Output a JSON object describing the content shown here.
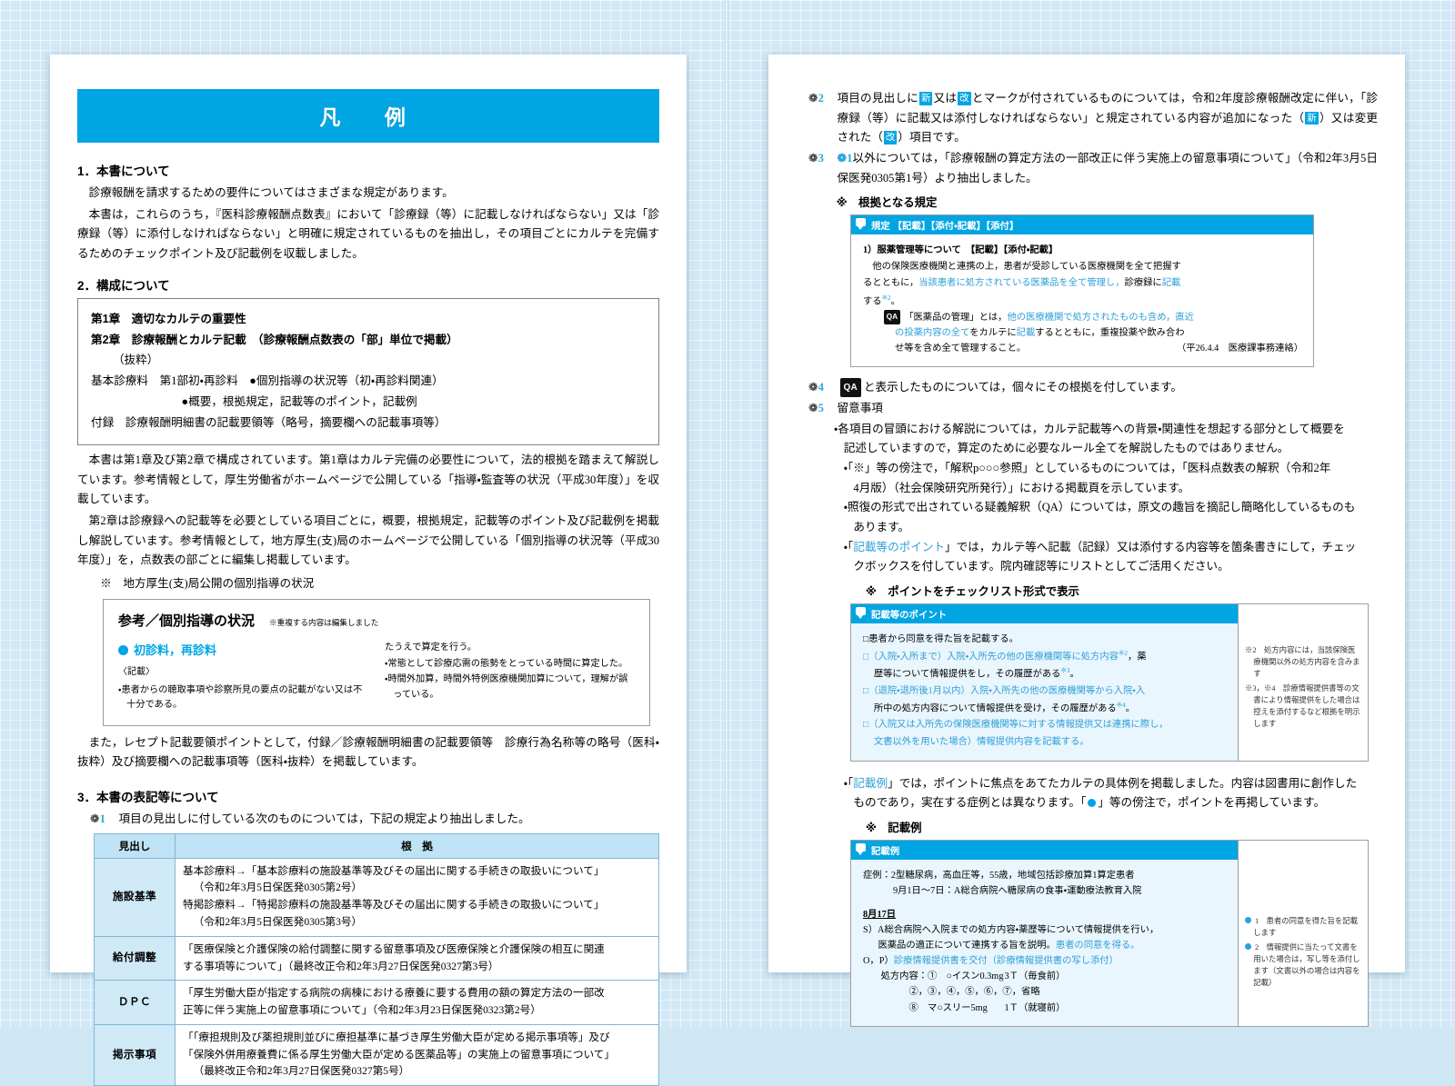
{
  "left_page": {
    "banner_title": "凡　例",
    "section1": {
      "heading": "1．本書について",
      "p1": "診療報酬を請求するための要件についてはさまざまな規定があります。",
      "p2": "本書は，これらのうち，『医科診療報酬点数表』において「診療録（等）に記載しなければならない」又は「診療録（等）に添付しなければならない」と明確に規定されているものを抽出し，その項目ごとにカルテを完備するためのチェックポイント及び記載例を収載しました。"
    },
    "section2": {
      "heading": "2．構成について",
      "outline": {
        "line1": "第1章　適切なカルテの重要性",
        "line2": "第2章　診療報酬とカルテ記載　（診療報酬点数表の「部」単位で掲載）",
        "line3": "（抜粋）",
        "line4": "基本診療料　第1部初・再診料　●個別指導の状況等（初・再診料関連）",
        "line5": "●概要，根拠規定，記載等のポイント，記載例",
        "line6": "付録　診療報酬明細書の記載要領等（略号，摘要欄への記載事項等）"
      },
      "p1": "本書は第1章及び第2章で構成されています。第1章はカルテ完備の必要性について，法的根拠を踏まえて解説しています。参考情報として，厚生労働省がホームページで公開している「指導・監査等の状況（平成30年度）」を収載しています。",
      "p2": "第2章は診療録への記載等を必要としている項目ごとに，概要，根拠規定，記載等のポイント及び記載例を掲載し解説しています。参考情報として，地方厚生(支)局のホームページで公開している「個別指導の状況等（平成30年度）」を，点数表の部ごとに編集し掲載しています。",
      "note": "※　地方厚生(支)局公開の個別指導の状況",
      "ref_box": {
        "title": "参考／個別指導の状況",
        "subtitle": "※重複する内容は編集しました",
        "col1_head": "初診料，再診料",
        "col1_label": "〈記載〉",
        "col1_item1": "・患者からの聴取事項や診察所見の要点の記載がない又は不十分である。",
        "col2_item0": "たうえで算定を行う。",
        "col2_item1": "・常態として診療応需の態勢をとっている時間に算定した。",
        "col2_item2": "・時間外加算，時間外特例医療機関加算について，理解が誤っている。"
      },
      "p3": "また，レセプト記載要領ポイントとして，付録／診療報酬明細書の記載要領等　診療行為名称等の略号（医科・抜粋）及び摘要欄への記載事項等（医科・抜粋）を掲載しています。"
    },
    "section3": {
      "heading": "3．本書の表記等について",
      "note1_num": "1",
      "note1": "項目の見出しに付している次のものについては，下記の規定より抽出しました。",
      "table": {
        "headers": [
          "見出し",
          "根　拠"
        ],
        "rows": [
          {
            "label": "施設基準",
            "lines": [
              "基本診療料→「基本診療料の施設基準等及びその届出に関する手続きの取扱いについて」",
              "（令和2年3月5日保医発0305第2号）",
              "特掲診療料→「特掲診療料の施設基準等及びその届出に関する手続きの取扱いについて」",
              "（令和2年3月5日保医発0305第3号）"
            ]
          },
          {
            "label": "給付調整",
            "lines": [
              "「医療保険と介護保険の給付調整に関する留意事項及び医療保険と介護保険の相互に関連",
              "する事項等について」（最終改正令和2年3月27日保医発0327第3号）"
            ]
          },
          {
            "label": "ＤＰＣ",
            "lines": [
              "「厚生労働大臣が指定する病院の病棟における療養に要する費用の額の算定方法の一部改",
              "正等に伴う実施上の留意事項について」（令和2年3月23日保医発0323第2号）"
            ]
          },
          {
            "label": "掲示事項",
            "lines": [
              "「「療担規則及び薬担規則並びに療担基準に基づき厚生労働大臣が定める掲示事項等」及び",
              "「保険外併用療養費に係る厚生労働大臣が定める医薬品等」の実施上の留意事項について」",
              "（最終改正令和2年3月27日保医発0327第5号）"
            ]
          }
        ]
      }
    }
  },
  "right_page": {
    "note2": {
      "num": "2",
      "tag_new": "新",
      "tag_kai": "改",
      "line1_a": "項目の見出しに",
      "line1_b": "又は",
      "line1_c": "とマークが付されているものについては，令和2年度診療報酬改定に伴い，",
      "line2_a": "「診療録（等）に記載又は添付しなければならない」と規定されている内容が追加になった（",
      "line2_b": "）又は",
      "line3_a": "変更された（",
      "line3_b": "）項目です。"
    },
    "note3": {
      "num": "3",
      "ref_num": "1",
      "text_a": "以外については，「診療報酬の算定方法の一部改正に伴う実施上の留意事項について」（令和2年",
      "text_b": "3月5日保医発0305第1号）より抽出しました。"
    },
    "kitei_label": "※　根拠となる規定",
    "kitei_panel": {
      "bar": "規定 【記載】【添付・記載】【添付】",
      "l1": "1）服薬管理等について　【記載】【添付・記載】",
      "l2_a": "他の保険医療機関と連携の上，患者が受診している医療機関を全て把握す",
      "l2_b": "るとともに，",
      "l2_c": "当該患者に処方されている医薬品を全て管理し，",
      "l2_d": "診療録に",
      "l2_e": "記載",
      "l2_f": "する",
      "l2_sup": "※2",
      "l2_g": "。",
      "qa_badge": "QA",
      "l3_a": "「医薬品の管理」とは，",
      "l3_b": "他の医療機関で処方されたものも含め，直近",
      "l3_c": "の投薬内容の全て",
      "l3_d": "をカルテに",
      "l3_e": "記載",
      "l3_f": "するとともに，重複投薬や飲み合わ",
      "l3_g": "せ等を含め全て管理すること。",
      "source": "（平26.4.4　医療課事務連絡）"
    },
    "note4": {
      "num": "4",
      "badge": "QA",
      "text": "と表示したものについては，個々にその根拠を付しています。"
    },
    "note5": {
      "num": "5",
      "heading": "留意事項",
      "b1_l1": "・各項目の冒頭における解説については，カルテ記載等への背景・関連性を想起する部分として概要を",
      "b1_l2": "記述していますので，算定のために必要なルール全てを解説したものではありません。",
      "b2_l1": "・「※」等の傍注で，「解釈p○○○参照」としているものについては，「医科点数表の解釈（令和2年",
      "b2_l2": "4月版）（社会保険研究所発行）」における掲載頁を示しています。",
      "b3_l1": "・照復の形式で出されている疑義解釈（QA）については，原文の趣旨を摘記し簡略化しているものも",
      "b3_l2": "あります。",
      "b4_l1_a": "・「",
      "b4_l1_blue": "記載等のポイント",
      "b4_l1_b": "」では，カルテ等へ記載（記録）又は添付する内容等を箇条書きにして，チェッ",
      "b4_l2": "クボックスを付しています。院内確認等にリストとしてご活用ください。"
    },
    "checklist_label": "※　ポイントをチェックリスト形式で表示",
    "checklist_panel": {
      "bar": "記載等のポイント",
      "c1": "□患者から同意を得た旨を記載する。",
      "c2_a": "□（入院・入所まで）入院・入所先の他の医療機関等に処方内容",
      "c2_sup": "※2",
      "c2_b": "，薬",
      "c2_l2_a": "歴等について情報提供をし，その履歴がある",
      "c2_l2_sup": "※3",
      "c2_l2_b": "。",
      "c3_a": "□（退院・退所後1月以内）入院・入所先の他の医療機関等から入院・入",
      "c3_l2_a": "所中の処方内容について情報提供を受け，その履歴がある",
      "c3_l2_sup": "※4",
      "c3_l2_b": "。",
      "c4_l1": "□（入院又は入所先の保険医療機関等に対する情報提供又は連携に際し，",
      "c4_l2": "文書以外を用いた場合）情報提供内容を記載する。",
      "side": [
        "※2　処方内容には，当該保険医療機関以外の処方内容を含みます",
        "※3，※4　診療情報提供書等の文書により情報提供をした場合は控えを添付するなど根拠を明示します"
      ]
    },
    "kisairei_intro_l1_a": "・「",
    "kisairei_intro_blue": "記載例",
    "kisairei_intro_l1_b": "」では，ポイントに焦点をあてたカルテの具体例を掲載しました。内容は図書用に創作した",
    "kisairei_intro_l2_a": "ものであり，実在する症例とは異なります。「",
    "kisairei_intro_l2_b": "」等の傍注で，ポイントを再掲しています。",
    "kisairei_label": "※　記載例",
    "kisairei_panel": {
      "bar": "記載例",
      "case_l1": "症例：2型糖尿病，高血圧等，55歳，地域包括診療加算1算定患者",
      "case_l2": "9月1日～7日：A総合病院へ糖尿病の食事・運動療法教育入院",
      "date": "8月17日",
      "s_l1": "S）A総合病院へ入院までの処方内容・薬歴等について情報提供を行い，",
      "s_l2_a": "医薬品の適正について連携する旨を説明。",
      "s_l2_blue": "患者の同意を得る。",
      "op_a": "O，P）",
      "op_blue": "診療情報提供書を交付（診療情報提供書の写し添付）",
      "rx_head": "処方内容：①　○イスン0.3mg",
      "rx_head_dose": "3Ｔ（毎食前）",
      "rx_l2": "②，③，④，⑤，⑥，⑦，省略",
      "rx_l3": "⑧　マ○スリー5mg",
      "rx_l3_dose": "1Ｔ（就寝前）",
      "side": [
        "1　患者の同意を得た旨を記載します",
        "2　情報提供に当たって文書を用いた場合は，写し等を添付します（文書以外の場合は内容を記載）"
      ]
    }
  },
  "colors": {
    "accent": "#00a5e3",
    "accent_light": "#2f9fd8",
    "table_header": "#bfe2f4",
    "table_label": "#cfe9f7",
    "panel_tint": "#e9f6fd"
  }
}
